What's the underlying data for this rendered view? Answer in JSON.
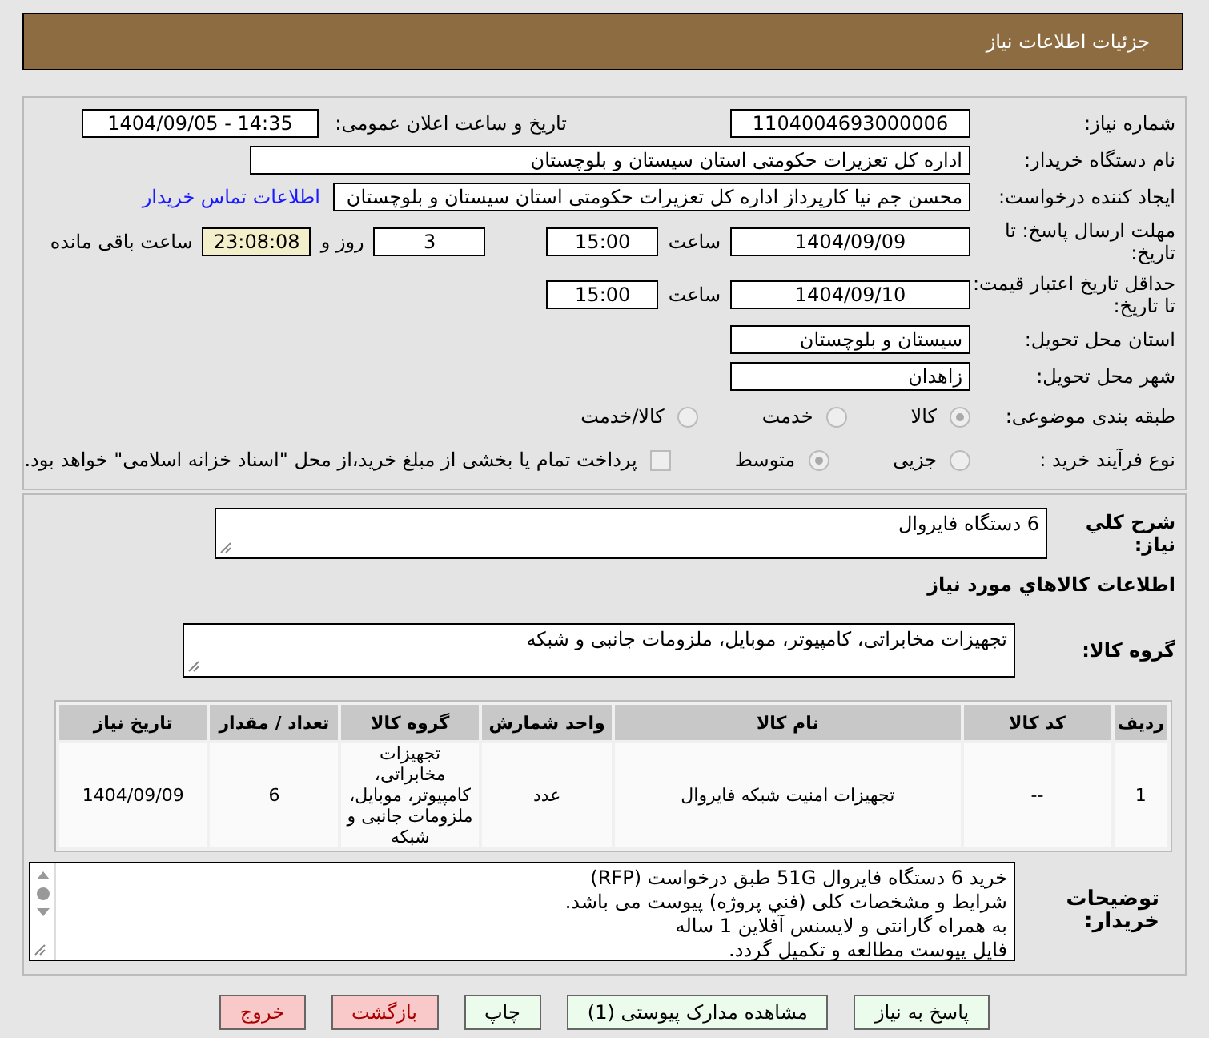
{
  "header": {
    "title": "جزئیات اطلاعات نیاز"
  },
  "need_info": {
    "need_number": {
      "label": "شماره نیاز:",
      "value": "1104004693000006"
    },
    "announce_date": {
      "label": "تاریخ و ساعت اعلان عمومی:",
      "value": "1404/09/05 - 14:35"
    },
    "buyer_org": {
      "label": "نام دستگاه خریدار:",
      "value": "اداره کل تعزیرات حکومتی استان سیستان و بلوچستان"
    },
    "requester": {
      "label": "ایجاد کننده درخواست:",
      "value": "محسن جم نیا کارپرداز اداره کل تعزیرات حکومتی استان سیستان و بلوچستان"
    },
    "contact_link": "اطلاعات تماس خریدار",
    "deadline": {
      "label": "مهلت ارسال پاسخ: تا تاریخ:",
      "date": "1404/09/09",
      "time_label": "ساعت",
      "time": "15:00",
      "days": "3",
      "days_label": "روز و",
      "remaining": "23:08:08",
      "remaining_label": "ساعت باقی مانده"
    },
    "validity": {
      "label": "حداقل تاریخ اعتبار قیمت: تا تاریخ:",
      "date": "1404/09/10",
      "time_label": "ساعت",
      "time": "15:00"
    },
    "province": {
      "label": "استان محل تحویل:",
      "value": "سیستان و بلوچستان"
    },
    "city": {
      "label": "شهر محل تحویل:",
      "value": "زاهدان"
    },
    "category": {
      "label": "طبقه بندی موضوعی:",
      "options": [
        {
          "label": "کالا",
          "selected": true
        },
        {
          "label": "خدمت",
          "selected": false
        },
        {
          "label": "کالا/خدمت",
          "selected": false
        }
      ]
    },
    "process": {
      "label": "نوع فرآیند خرید :",
      "options": [
        {
          "label": "جزیی",
          "selected": false
        },
        {
          "label": "متوسط",
          "selected": true
        }
      ],
      "treasury": {
        "label": "پرداخت تمام یا بخشی از مبلغ خرید،از محل \"اسناد خزانه اسلامی\" خواهد بود.",
        "checked": false
      }
    }
  },
  "description": {
    "label": "شرح کلي نياز:",
    "value": "6 دستگاه فایروال"
  },
  "goods_heading": "اطلاعات کالاهاي مورد نياز",
  "goods_group": {
    "label": "گروه کالا:",
    "value": "تجهیزات مخابراتی، کامپیوتر، موبایل، ملزومات جانبی و شبکه"
  },
  "table": {
    "columns": [
      "ردیف",
      "کد کالا",
      "نام کالا",
      "واحد شمارش",
      "گروه کالا",
      "تعداد / مقدار",
      "تاریخ نیاز"
    ],
    "rows": [
      [
        "1",
        "--",
        "تجهیزات امنیت شبکه فایروال",
        "عدد",
        "تجهیزات مخابراتی، کامپیوتر، موبایل، ملزومات جانبی و شبکه",
        "6",
        "1404/09/09"
      ]
    ]
  },
  "buyer_notes": {
    "label": "توضیحات خریدار:",
    "lines": [
      "خرید 6 دستگاه فایروال 51G  طبق درخواست (RFP)",
      "شرایط و مشخصات کلی (فني پروژه) پیوست می باشد.",
      "به همراه گارانتی و لایسنس آفلاین 1 ساله",
      "فایل پیوست مطالعه و تکمیل گردد."
    ]
  },
  "buttons": [
    {
      "label": "پاسخ به نیاز",
      "kind": "primary"
    },
    {
      "label": "مشاهده مدارک پیوستی (1)",
      "kind": "primary"
    },
    {
      "label": "چاپ",
      "kind": "primary"
    },
    {
      "label": "بازگشت",
      "kind": "danger"
    },
    {
      "label": "خروج",
      "kind": "danger"
    }
  ]
}
